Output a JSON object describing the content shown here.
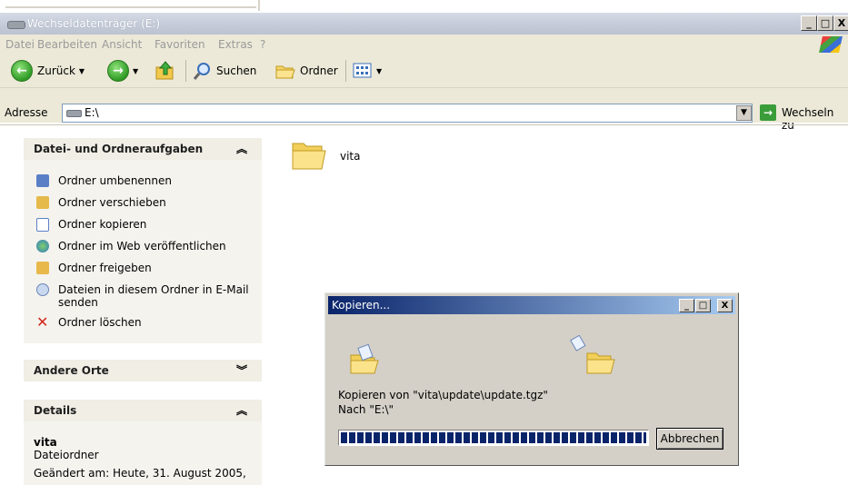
{
  "window": {
    "title": "Wechseldatenträger (E:)",
    "controls": {
      "minimize": "_",
      "maximize": "□",
      "close": "X"
    }
  },
  "menu": {
    "items": [
      "Datei",
      "Bearbeiten",
      "Ansicht",
      "Favoriten",
      "Extras",
      "?"
    ]
  },
  "toolbar": {
    "back_label": "Zurück",
    "search_label": "Suchen",
    "folders_label": "Ordner"
  },
  "address": {
    "label": "Adresse",
    "value": "E:\\",
    "go_label": "Wechseln zu"
  },
  "tasks_panel": {
    "title": "Datei- und Ordneraufgaben",
    "items": [
      {
        "label": "Ordner umbenennen",
        "icon": "rename-icon"
      },
      {
        "label": "Ordner verschieben",
        "icon": "move-icon"
      },
      {
        "label": "Ordner kopieren",
        "icon": "copy-icon"
      },
      {
        "label": "Ordner im Web veröffentlichen",
        "icon": "publish-web-icon"
      },
      {
        "label": "Ordner freigeben",
        "icon": "share-icon"
      },
      {
        "label": "Dateien in diesem Ordner in E-Mail senden",
        "icon": "email-icon"
      },
      {
        "label": "Ordner löschen",
        "icon": "delete-icon"
      }
    ]
  },
  "other_places": {
    "title": "Andere Orte"
  },
  "details": {
    "title": "Details",
    "name": "vita",
    "type": "Dateiordner",
    "modified": "Geändert am: Heute, 31. August 2005,"
  },
  "content": {
    "folders": [
      {
        "name": "vita"
      }
    ]
  },
  "copy_dialog": {
    "title": "Kopieren...",
    "from_text": "Kopieren von \"vita\\update\\update.tgz\"",
    "to_text": "Nach \"E:\\\"",
    "progress": 1.0,
    "cancel_label": "Abbrechen"
  },
  "colors": {
    "dialog_title_start": "#0a246a",
    "dialog_title_end": "#a6caf0",
    "go_green": "#3a9d3a"
  }
}
